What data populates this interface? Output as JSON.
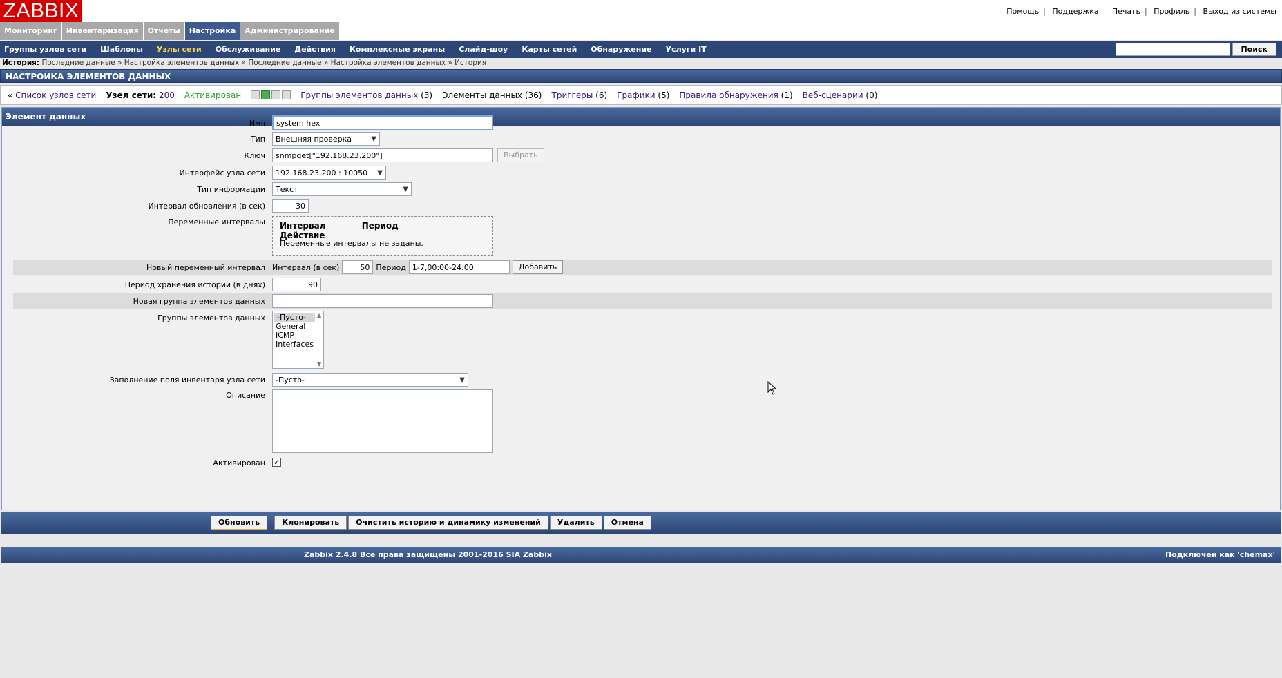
{
  "logo": "ZABBIX",
  "top_links": [
    "Помощь",
    "Поддержка",
    "Печать",
    "Профиль",
    "Выход из системы"
  ],
  "main_menu": [
    "Мониторинг",
    "Инвентаризация",
    "Отчеты",
    "Настройка",
    "Администрирование"
  ],
  "main_menu_active": "Настройка",
  "sub_menu": [
    "Группы узлов сети",
    "Шаблоны",
    "Узлы сети",
    "Обслуживание",
    "Действия",
    "Комплексные экраны",
    "Слайд-шоу",
    "Карты сетей",
    "Обнаружение",
    "Услуги IT"
  ],
  "sub_menu_active": "Узлы сети",
  "search": {
    "value": "",
    "button": "Поиск"
  },
  "history": {
    "label": "История:",
    "items": [
      "Последние данные",
      "Настройка элементов данных",
      "Последние данные",
      "Настройка элементов данных",
      "История"
    ]
  },
  "page_title": "НАСТРОЙКА ЭЛЕМЕНТОВ ДАННЫХ",
  "host_bar": {
    "back_prefix": "«",
    "host_list": "Список узлов сети",
    "host_label": "Узел сети:",
    "host_name": "200",
    "status": "Активирован",
    "app_link": "Группы элементов данных",
    "app_count": "(3)",
    "items_label": "Элементы данных",
    "items_count": "(36)",
    "triggers_link": "Триггеры",
    "triggers_count": "(6)",
    "graphs_link": "Графики",
    "graphs_count": "(5)",
    "discovery_link": "Правила обнаружения",
    "discovery_count": "(1)",
    "web_link": "Веб-сценарии",
    "web_count": "(0)"
  },
  "form": {
    "panel_title": "Элемент данных",
    "name_label": "Имя",
    "name_value": "system hex",
    "type_label": "Тип",
    "type_value": "Внешняя проверка",
    "key_label": "Ключ",
    "key_value": "snmpget[\"192.168.23.200\"]",
    "select_button": "Выбрать",
    "interface_label": "Интерфейс узла сети",
    "interface_value": "192.168.23.200 : 10050",
    "info_type_label": "Тип информации",
    "info_type_value": "Текст",
    "update_interval_label": "Интервал обновления (в сек)",
    "update_interval_value": "30",
    "flex_label": "Переменные интервалы",
    "flex_headers": [
      "Интервал",
      "Период",
      "Действие"
    ],
    "flex_empty": "Переменные интервалы не заданы.",
    "new_flex_label": "Новый переменный интервал",
    "new_flex_interval_label": "Интервал (в сек)",
    "new_flex_interval_value": "50",
    "new_flex_period_label": "Период",
    "new_flex_period_value": "1-7,00:00-24:00",
    "add_button": "Добавить",
    "history_label": "Период хранения истории (в днях)",
    "history_value": "90",
    "new_app_label": "Новая группа элементов данных",
    "new_app_value": "",
    "apps_label": "Группы элементов данных",
    "apps_options": [
      "-Пусто-",
      "General",
      "ICMP",
      "Interfaces"
    ],
    "inventory_label": "Заполнение поля инвентаря узла сети",
    "inventory_value": "-Пусто-",
    "description_label": "Описание",
    "description_value": "",
    "enabled_label": "Активирован",
    "enabled_check": "✓"
  },
  "buttons": [
    "Обновить",
    "Клонировать",
    "Очистить историю и динамику изменений",
    "Удалить",
    "Отмена"
  ],
  "footer": {
    "copyright": "Zabbix 2.4.8 Все права защищены 2001-2016 SIA Zabbix",
    "connected": "Подключен как 'chemax'"
  }
}
